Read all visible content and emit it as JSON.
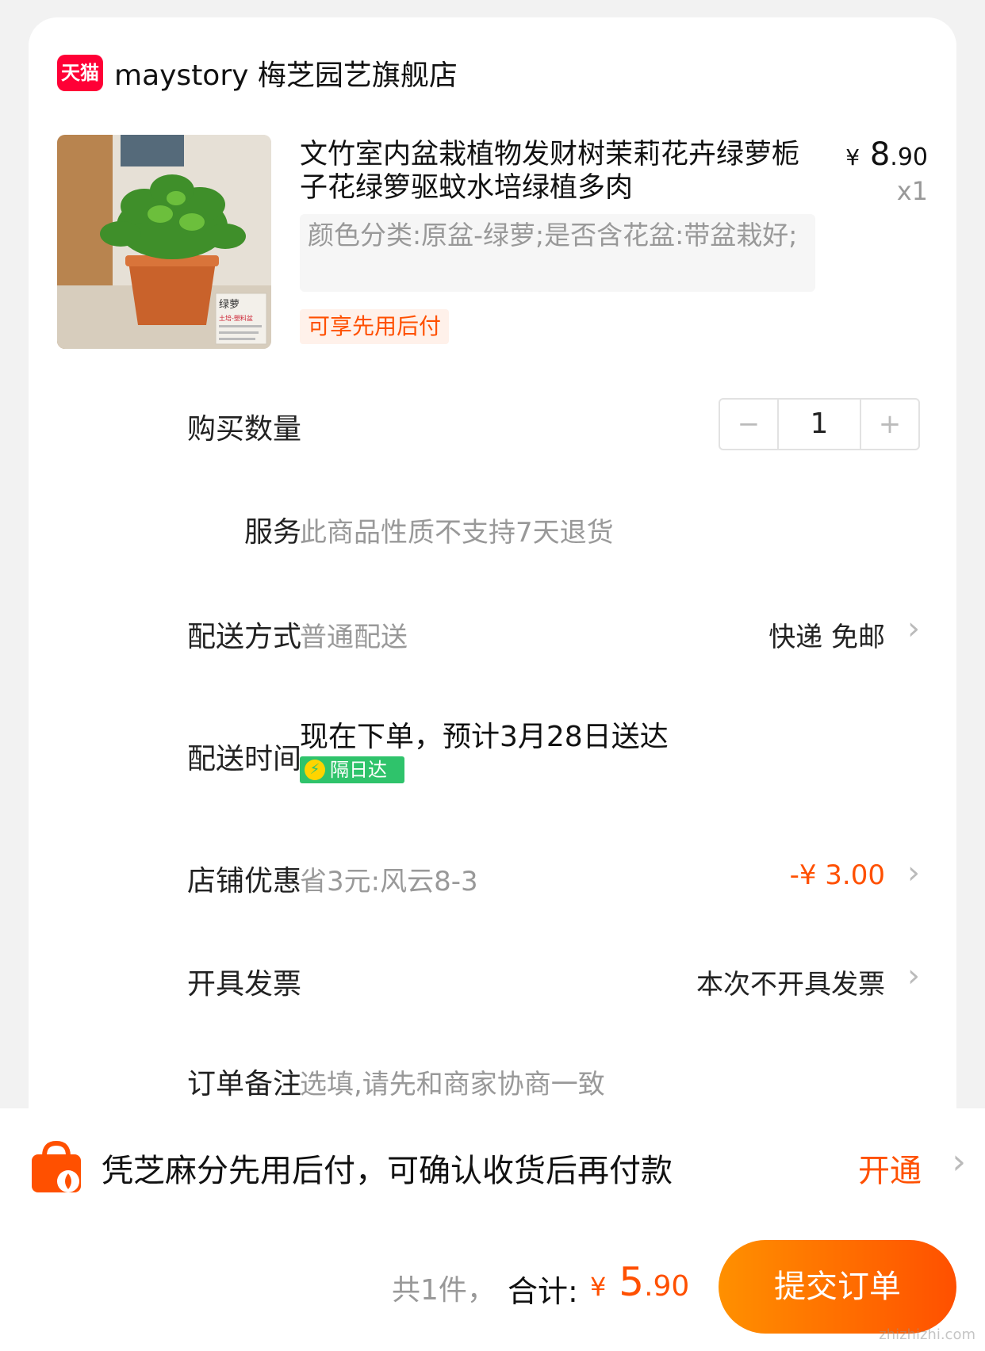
{
  "store": {
    "platform_badge": "天猫",
    "name": "maystory 梅芝园艺旗舰店"
  },
  "product": {
    "title": "文竹室内盆栽植物发财树茉莉花卉绿萝栀子花绿箩驱蚊水培绿植多肉",
    "price_symbol": "¥",
    "price_int": "8",
    "price_dec": ".90",
    "quantity": "x1",
    "sku": "颜色分类:原盆-绿萝;是否含花盆:带盆栽好;",
    "bnpl_tag": "可享先用后付",
    "image_label": "绿萝",
    "image_caption": "土培-塑料盆"
  },
  "quantity_row": {
    "label": "购买数量",
    "value": "1",
    "minus": "−",
    "plus": "+"
  },
  "service_row": {
    "label": "服务",
    "value": "此商品性质不支持7天退货"
  },
  "shipping_row": {
    "label": "配送方式",
    "value": "普通配送",
    "right": "快递 免邮"
  },
  "delivery_row": {
    "label": "配送时间",
    "value": "现在下单，预计3月28日送达",
    "badge": "隔日达"
  },
  "coupon_row": {
    "label": "店铺优惠",
    "value": "省3元:风云8-3",
    "amount": "-¥ 3.00"
  },
  "invoice_row": {
    "label": "开具发票",
    "right": "本次不开具发票"
  },
  "note_row": {
    "label": "订单备注",
    "placeholder": "选填,请先和商家协商一致"
  },
  "bnpl_bar": {
    "text": "凭芝麻分先用后付，可确认收货后再付款",
    "action": "开通"
  },
  "footer": {
    "count": "共1件，",
    "total_label": "合计:",
    "total_symbol": "¥",
    "total_int": " 5",
    "total_dec": ".90",
    "submit": "提交订单"
  },
  "watermark": "zhizhizhi.com",
  "colors": {
    "accent": "#ff5000",
    "tmall_red": "#ff0036",
    "fast_green": "#2fc36b"
  },
  "icons": [
    "chevron-right-icon",
    "shopping-bag-icon",
    "lightning-icon"
  ]
}
